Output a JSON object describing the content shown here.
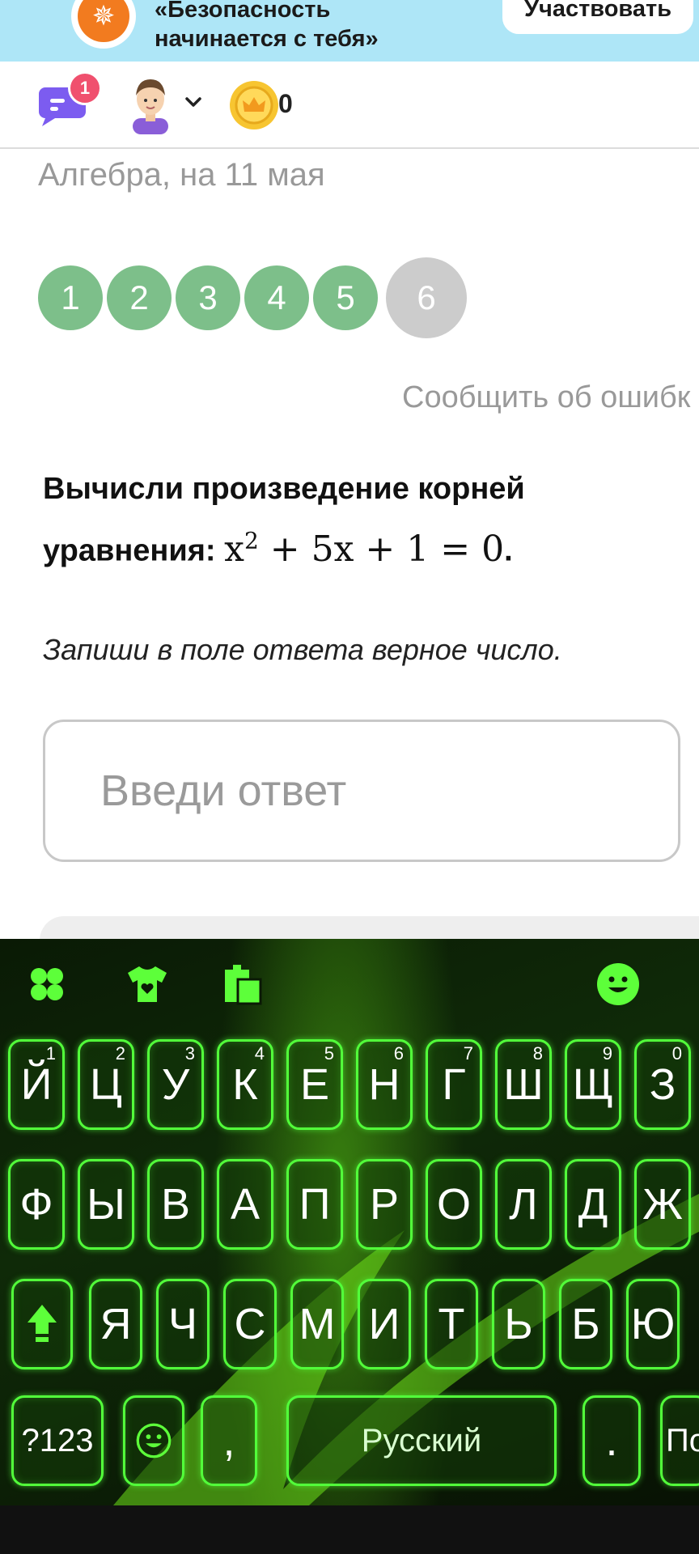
{
  "banner": {
    "line1": "«Безопасность",
    "line2": "начинается с тебя»",
    "button": "Участвовать",
    "logo_icon": "compass-icon"
  },
  "header": {
    "notifications": "1",
    "coins": "0",
    "icons": [
      "chat-icon",
      "avatar",
      "chevron-down-icon",
      "crown-coin-icon"
    ]
  },
  "lesson": {
    "breadcrumb": "Алгебра, на 11 мая",
    "steps": [
      "1",
      "2",
      "3",
      "4",
      "5",
      "6"
    ],
    "current_step": "6",
    "report_error": "Сообщить об ошибк",
    "question_text": "Вычисли произведение корней уравнения:",
    "equation": "x² + 5x + 1 = 0",
    "equation_base": "x",
    "equation_exp": "2",
    "equation_rest": " + 5x + 1 = 0",
    "equation_end": ".",
    "instruction": "Запиши в поле ответа верное число.",
    "answer_placeholder": "Введи ответ"
  },
  "keyboard": {
    "toolbar_icons": [
      "clover-icon",
      "tshirt-icon",
      "clipboard-icon",
      "emoji-icon"
    ],
    "row1": [
      "Й",
      "Ц",
      "У",
      "К",
      "Е",
      "Н",
      "Г",
      "Ш",
      "Щ",
      "З"
    ],
    "row1_hints": [
      "1",
      "2",
      "3",
      "4",
      "5",
      "6",
      "7",
      "8",
      "9",
      "0"
    ],
    "row2": [
      "Ф",
      "Ы",
      "В",
      "А",
      "П",
      "Р",
      "О",
      "Л",
      "Д",
      "Ж"
    ],
    "row3": [
      "Я",
      "Ч",
      "С",
      "М",
      "И",
      "Т",
      "Ь",
      "Б",
      "Ю"
    ],
    "symbols_key": "?123",
    "comma_key": ",",
    "space_label": "Русский",
    "period_key": ".",
    "enter_key": "По",
    "colors": {
      "accent": "#52ff3a",
      "step_done": "#7dbf8a",
      "step_current": "#cccccc"
    }
  }
}
